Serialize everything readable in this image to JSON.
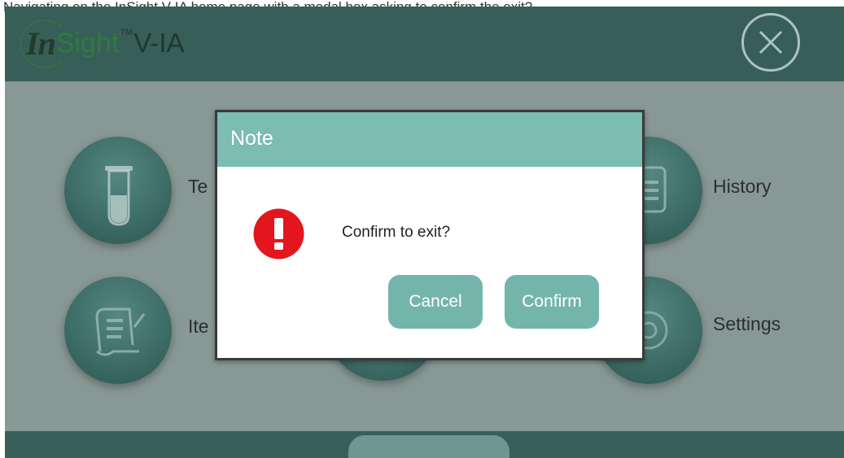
{
  "caption": "Navigating on the InSight V-IA home page with a modal box asking to confirm the exit?",
  "header": {
    "logo_in": "In",
    "logo_sight": "Sight",
    "logo_tm": "TM",
    "logo_model": "V-IA",
    "close_icon": "close-circle-icon"
  },
  "menu": {
    "test": {
      "label": "Te",
      "icon": "test-tube-icon"
    },
    "item": {
      "label": "Ite",
      "icon": "document-scroll-icon"
    },
    "history": {
      "label": "History",
      "icon": "clipboard-icon"
    },
    "settings": {
      "label": "Settings",
      "icon": "gear-icon"
    }
  },
  "dialog": {
    "title": "Note",
    "message": "Confirm to exit?",
    "icon": "exclamation-icon",
    "cancel_label": "Cancel",
    "confirm_label": "Confirm"
  },
  "colors": {
    "header_bg": "#2c5750",
    "dialog_header": "#7bbcb3",
    "dialog_button": "#74b5ab",
    "warning_red": "#e3161e",
    "overlay": "#8e9e9a"
  }
}
